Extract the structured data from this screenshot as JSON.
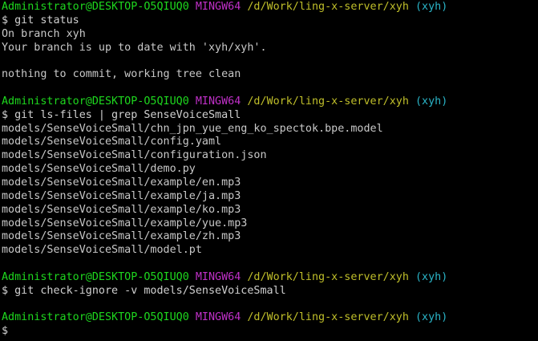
{
  "prompt": {
    "user_host": "Administrator@DESKTOP-O5QIUQ0",
    "shell": "MINGW64",
    "path": "/d/Work/ling-x-server/xyh",
    "branch": "(xyh)",
    "symbol": "$"
  },
  "blocks": [
    {
      "command": "git status",
      "output": [
        "On branch xyh",
        "Your branch is up to date with 'xyh/xyh'.",
        "",
        "nothing to commit, working tree clean"
      ]
    },
    {
      "command": "git ls-files | grep SenseVoiceSmall",
      "output": [
        "models/SenseVoiceSmall/chn_jpn_yue_eng_ko_spectok.bpe.model",
        "models/SenseVoiceSmall/config.yaml",
        "models/SenseVoiceSmall/configuration.json",
        "models/SenseVoiceSmall/demo.py",
        "models/SenseVoiceSmall/example/en.mp3",
        "models/SenseVoiceSmall/example/ja.mp3",
        "models/SenseVoiceSmall/example/ko.mp3",
        "models/SenseVoiceSmall/example/yue.mp3",
        "models/SenseVoiceSmall/example/zh.mp3",
        "models/SenseVoiceSmall/model.pt"
      ]
    },
    {
      "command": "git check-ignore -v models/SenseVoiceSmall",
      "output": []
    },
    {
      "command": "",
      "output": []
    }
  ],
  "colors": {
    "background": "#000000",
    "user_host": "#1ed81e",
    "shell": "#c030c8",
    "path": "#c0bf2a",
    "branch": "#2ab5c8",
    "text": "#c8c8c8"
  }
}
